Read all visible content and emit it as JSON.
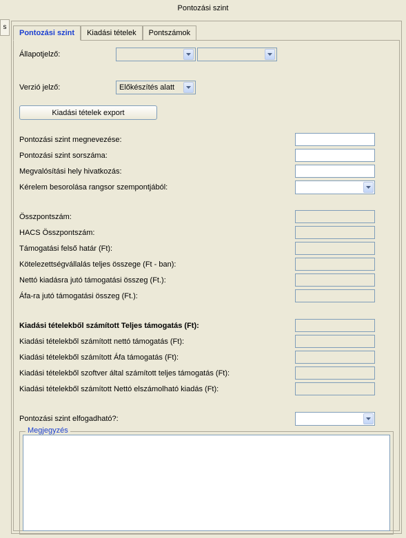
{
  "window": {
    "title": "Pontozási szint"
  },
  "left_edge": "s",
  "tabs": [
    {
      "label": "Pontozási szint",
      "active": true
    },
    {
      "label": "Kiadási tételek",
      "active": false
    },
    {
      "label": "Pontszámok",
      "active": false
    }
  ],
  "status": {
    "label": "Állapotjelző:",
    "value1": "",
    "value2": ""
  },
  "verzio": {
    "label": "Verzió jelző:",
    "value": "Előkészítés alatt"
  },
  "export_button": "Kiadási tételek export",
  "fields_a": [
    {
      "label": "Pontozási szint megnevezése:",
      "value": "",
      "type": "text"
    },
    {
      "label": "Pontozási szint sorszáma:",
      "value": "",
      "type": "text"
    },
    {
      "label": "Megvalósítási hely hivatkozás:",
      "value": "",
      "type": "text"
    },
    {
      "label": "Kérelem besorolása rangsor szempontjából:",
      "value": "",
      "type": "select"
    }
  ],
  "fields_b": [
    {
      "label": "Összpontszám:",
      "value": ""
    },
    {
      "label": "HACS Összpontszám:",
      "value": ""
    },
    {
      "label": "Támogatási felső határ (Ft):",
      "value": ""
    },
    {
      "label": "Kötelezettségvállalás teljes összege (Ft - ban):",
      "value": ""
    },
    {
      "label": "Nettó kiadásra jutó támogatási összeg (Ft.):",
      "value": ""
    },
    {
      "label": "Áfa-ra jutó támogatási összeg (Ft.):",
      "value": ""
    }
  ],
  "fields_c_header": "Kiadási tételekből számított Teljes támogatás (Ft):",
  "fields_c": [
    {
      "label": "Kiadási tételekből számított nettó támogatás (Ft):",
      "value": ""
    },
    {
      "label": "Kiadási tételekből számított Áfa támogatás (Ft):",
      "value": ""
    },
    {
      "label": "Kiadási tételekből szoftver által számított teljes támogatás (Ft):",
      "value": ""
    },
    {
      "label": "Kiadási tételekből számított Nettó elszámolható kiadás (Ft):",
      "value": ""
    }
  ],
  "acceptable": {
    "label": "Pontozási szint elfogadható?:",
    "value": ""
  },
  "comment": {
    "legend": "Megjegyzés",
    "value": ""
  }
}
